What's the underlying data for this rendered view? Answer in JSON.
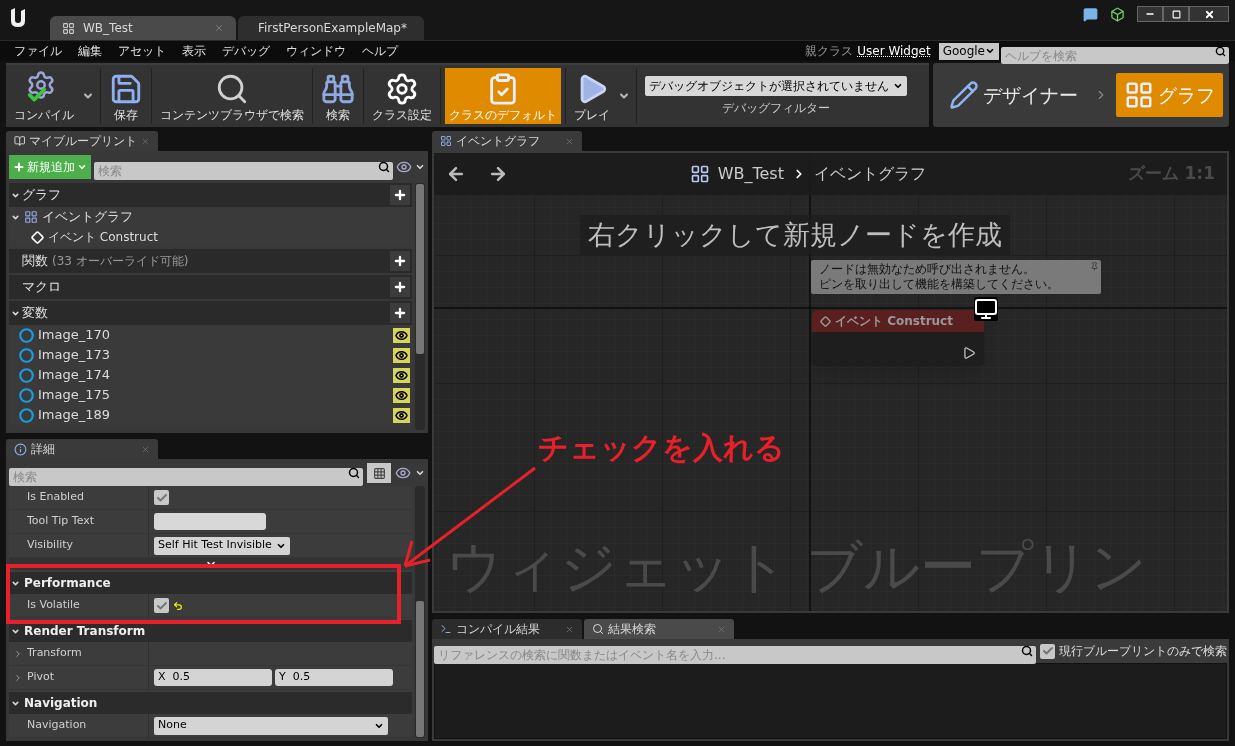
{
  "window": {
    "tabs": [
      {
        "label": "WB_Test",
        "selected": true
      },
      {
        "label": "FirstPersonExampleMap*",
        "selected": false
      }
    ]
  },
  "menu": [
    "ファイル",
    "編集",
    "アセット",
    "表示",
    "デバッグ",
    "ウィンドウ",
    "ヘルプ"
  ],
  "parent_class": {
    "label": "親クラス",
    "value": "User Widget"
  },
  "help_search": {
    "engine": "Google",
    "placeholder": "ヘルプを検索"
  },
  "toolbar": [
    {
      "label": "コンパイル",
      "kind": "compile",
      "selected": false,
      "dropdown": true
    },
    {
      "label": "保存",
      "kind": "save",
      "selected": false,
      "dropdown": false
    },
    {
      "label": "コンテンツブラウザで検索",
      "kind": "browse",
      "selected": false,
      "dropdown": false
    },
    {
      "label": "検索",
      "kind": "find",
      "selected": false,
      "dropdown": false
    },
    {
      "label": "クラス設定",
      "kind": "settings",
      "selected": false,
      "dropdown": false
    },
    {
      "label": "クラスのデフォルト",
      "kind": "defaults",
      "selected": true,
      "dropdown": false
    },
    {
      "label": "プレイ",
      "kind": "play",
      "selected": false,
      "dropdown": true
    }
  ],
  "debug_filter": {
    "value": "デバッグオブジェクトが選択されていません",
    "label": "デバッグフィルター"
  },
  "modes": [
    {
      "label": "デザイナー",
      "kind": "designer",
      "selected": false
    },
    {
      "label": "グラフ",
      "kind": "graph",
      "selected": true
    }
  ],
  "my_blueprint": {
    "tab": "マイブループリント",
    "add_button": "新規追加",
    "search_placeholder": "検索",
    "sections": [
      {
        "title": "グラフ",
        "expanded": true,
        "items": [
          {
            "label": "イベントグラフ",
            "kind": "graph",
            "expanded": true,
            "children": [
              {
                "label": "イベント Construct",
                "kind": "event"
              }
            ]
          }
        ]
      },
      {
        "title": "関数",
        "note": "(33 オーバーライド可能)",
        "expanded": false
      },
      {
        "title": "マクロ",
        "expanded": false
      },
      {
        "title": "変数",
        "expanded": true,
        "items": [
          {
            "label": "Image_170",
            "kind": "variable",
            "exposed": true
          },
          {
            "label": "Image_173",
            "kind": "variable",
            "exposed": true
          },
          {
            "label": "Image_174",
            "kind": "variable",
            "exposed": true
          },
          {
            "label": "Image_175",
            "kind": "variable",
            "exposed": true
          },
          {
            "label": "Image_189",
            "kind": "variable",
            "exposed": true
          }
        ]
      }
    ]
  },
  "details": {
    "tab": "詳細",
    "search_placeholder": "検索",
    "rows": [
      {
        "label": "Is Enabled",
        "kind": "checkbox",
        "checked": true,
        "modified": false
      },
      {
        "label": "Tool Tip Text",
        "kind": "text",
        "modified": false
      },
      {
        "label": "Visibility",
        "kind": "dropdown",
        "value": "Self Hit Test Invisible",
        "modified": false
      }
    ],
    "categories": [
      {
        "title": "Performance",
        "expanded": true,
        "rows": [
          {
            "label": "Is Volatile",
            "kind": "checkbox",
            "checked": true,
            "modified": true
          }
        ]
      },
      {
        "title": "Render Transform",
        "expanded": true,
        "rows": [
          {
            "label": "Transform",
            "kind": "none",
            "expanded": false,
            "modified": false
          },
          {
            "label": "Pivot",
            "kind": "vector",
            "expanded": false,
            "components": [
              {
                "axis": "X",
                "value": "0.5"
              },
              {
                "axis": "Y",
                "value": "0.5"
              }
            ],
            "modified": false
          }
        ]
      },
      {
        "title": "Navigation",
        "expanded": true,
        "rows": [
          {
            "label": "Navigation",
            "kind": "dropdown",
            "value": "None",
            "modified": false
          }
        ]
      }
    ]
  },
  "graph": {
    "tab": "イベントグラフ",
    "breadcrumb": [
      "WB_Test",
      "イベントグラフ"
    ],
    "zoom": "ズーム 1:1",
    "hint": "右クリックして新規ノードを作成",
    "node": {
      "title": "イベント Construct",
      "comment": [
        "ノードは無効なため呼び出されません。",
        "ピンを取り出して機能を構築してください。"
      ]
    },
    "watermark": "ウィジェット ブループリン"
  },
  "results": {
    "tabs": [
      {
        "label": "コンパイル結果",
        "kind": "compile",
        "selected": false
      },
      {
        "label": "結果検索",
        "kind": "find",
        "selected": true
      }
    ],
    "search_placeholder": "リファレンスの検索に関数またはイベント名を入力...",
    "scope": {
      "label": "現行ブループリントのみで検索",
      "checked": true
    }
  },
  "annotation": {
    "text": "チェックを入れる"
  }
}
